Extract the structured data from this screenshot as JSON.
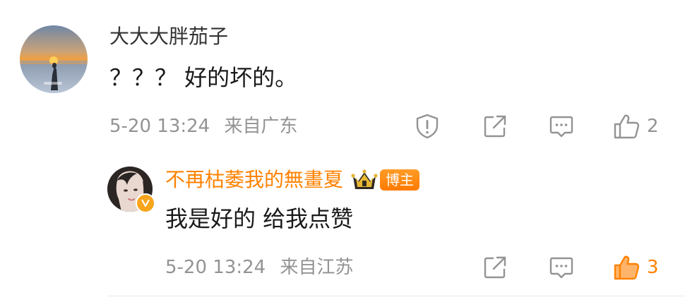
{
  "comment": {
    "username": "大大大胖茄子",
    "text": "？？？ 好的坏的。",
    "timestamp": "5-20 13:24",
    "location": "来自广东",
    "like_count": "2"
  },
  "reply": {
    "username": "不再枯萎我的無畫夏",
    "author_tag": "博主",
    "text": "我是好的 给我点赞",
    "timestamp": "5-20 13:24",
    "location": "来自江苏",
    "like_count": "3",
    "liked": true
  },
  "icons": {
    "report": "report-icon",
    "share": "share-icon",
    "reply": "comment-icon",
    "like": "thumbs-up-icon",
    "verified": "verified-badge-icon",
    "fan_crown": "crown-badge-icon"
  },
  "colors": {
    "accent": "#ff8200",
    "meta_gray": "#939393",
    "text": "#1a1a1a"
  }
}
